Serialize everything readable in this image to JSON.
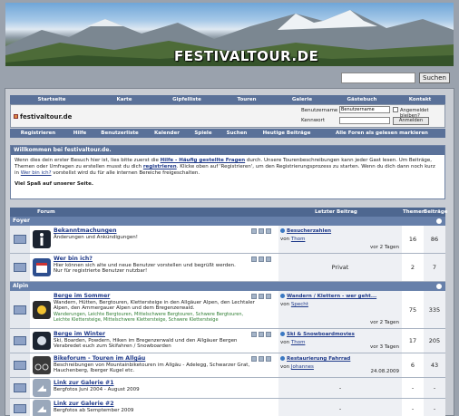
{
  "banner": {
    "logo_text": "FESTIVALTOUR.DE"
  },
  "search": {
    "placeholder": "",
    "button_label": "Suchen"
  },
  "nav_top": [
    "Startseite",
    "Karte",
    "Gipfelliste",
    "Touren",
    "Galerie",
    "Gästebuch",
    "Kontakt"
  ],
  "site": {
    "title": "festivaltour.de"
  },
  "login": {
    "username_label": "Benutzername",
    "username_value": "Benutzername",
    "password_label": "Kennwort",
    "remember_label": "Angemeldet bleiben?",
    "login_button": "Anmelden"
  },
  "nav_bottom": [
    "Registrieren",
    "Hilfe",
    "Benutzerliste",
    "Kalender",
    "Spiele",
    "Suchen",
    "Heutige Beiträge",
    "Alle Foren als gelesen markieren"
  ],
  "welcome": {
    "heading": "Willkommen bei festivaltour.de.",
    "p1_a": "Wenn dies dein erster Besuch hier ist, lies bitte zuerst die ",
    "p1_link1": "Hilfe - Häufig gestellte Fragen",
    "p1_b": " durch. Unsere Tourenbeschreibungen kann jeder Gast lesen. Um Beiträge, Themen oder Umfragen zu erstellen musst du dich ",
    "p1_link2": "registrieren",
    "p1_c": ". Klicke oben auf 'Registrieren', um den Registrierungsprozess zu starten. Wenn du dich dann noch kurz in ",
    "p1_link3": "Wer bin ich?",
    "p1_d": " vorstellst wird du für alle internen Bereiche freigeschalten.",
    "p2": "Viel Spaß auf unserer Seite."
  },
  "table_header": {
    "forum": "Forum",
    "last_post": "Letzter Beitrag",
    "topics": "Themen",
    "posts": "Beiträge"
  },
  "categories": [
    {
      "name": "Foyer",
      "forums": [
        {
          "title": "Bekanntmachungen",
          "desc": "Änderungen und Ankündigungen!",
          "desc2": "",
          "subs": "",
          "last_title": "Besucherzahlen",
          "last_by_prefix": "von ",
          "last_by": "Thom",
          "last_date": "vor 2 Tagen",
          "private": "",
          "topics": "16",
          "posts": "86"
        },
        {
          "title": "Wer bin ich?",
          "desc": "Hier können sich alte und neue Benutzer vorstellen und begrüßt werden.",
          "desc2": "Nur für registrierte Benutzer nutzbar!",
          "subs": "",
          "last_title": "",
          "last_by_prefix": "",
          "last_by": "",
          "last_date": "",
          "private": "Privat",
          "topics": "2",
          "posts": "7"
        }
      ]
    },
    {
      "name": "Alpin",
      "forums": [
        {
          "title": "Berge im Sommer",
          "desc": "Wandern, Hütten, Bergtouren, Klettersteige in den Allgäuer Alpen, den Lechtaler Alpen, den Ammergauer Alpen und dem Bregenzerwald.",
          "desc2": "",
          "subs": "Wanderungen, Leichte Bergtouren, Mittelschwere Bergtouren, Schwere Bergtouren, Leichte Klettersteige, Mittelschwere Klettersteige, Schwere Klettersteige",
          "last_title": "Wandern / Klettern - wer geht...",
          "last_by_prefix": "von ",
          "last_by": "Specht",
          "last_date": "vor 2 Tagen",
          "private": "",
          "topics": "75",
          "posts": "335"
        },
        {
          "title": "Berge im Winter",
          "desc": "Ski, Boarden, Powdern, Hiken im Bregenzerwald und den Allgäuer Bergen",
          "desc2": "Verabredet euch zum Skifahren / Snowboarden",
          "subs": "",
          "last_title": "Ski & Snowboardmovies",
          "last_by_prefix": "von ",
          "last_by": "Thom",
          "last_date": "vor 3 Tagen",
          "private": "",
          "topics": "17",
          "posts": "205"
        },
        {
          "title": "Bikeforum - Touren im Allgäu",
          "desc": "Beschreibungen von Mountainbiketouren im Allgäu - Adelegg, Schwarzer Grat,",
          "desc2": "Hauchenberg, Iberger Kugel etc.",
          "subs": "",
          "last_title": "Restaurierung Fahrrad",
          "last_by_prefix": "von ",
          "last_by": "Johannes",
          "last_date": "24.08.2009",
          "private": "",
          "topics": "6",
          "posts": "43"
        },
        {
          "title": "Link zur Galerie #1",
          "desc": "Bergfotos Juni 2004 - August 2009",
          "desc2": "",
          "subs": "",
          "last_title": "",
          "last_by_prefix": "",
          "last_by": "",
          "last_date": "",
          "private": "-",
          "topics": "-",
          "posts": "-"
        },
        {
          "title": "Link zur Galerie #2",
          "desc": "Bergfotos ab Semptember 2009",
          "desc2": "",
          "subs": "",
          "last_title": "",
          "last_by_prefix": "",
          "last_by": "",
          "last_date": "",
          "private": "-",
          "topics": "-",
          "posts": "-"
        }
      ]
    }
  ],
  "colors": {
    "nav": "#5a7199",
    "category": "#6780aa",
    "link": "#1f3a8a"
  }
}
